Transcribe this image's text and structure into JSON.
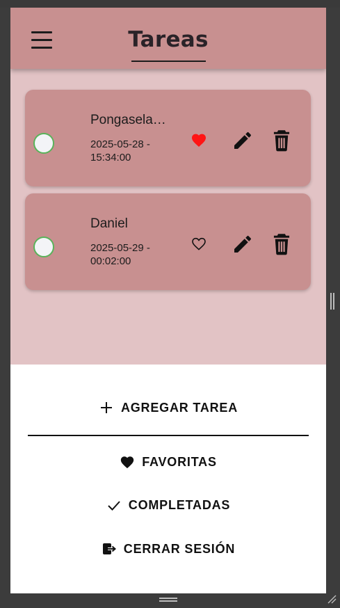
{
  "header": {
    "title": "Tareas",
    "menu_icon": "hamburger-menu-icon"
  },
  "tasks": [
    {
      "name": "Pongasela…",
      "date_line1": "2025-05-28 -",
      "date_line2": "15:34:00",
      "favorite": true,
      "completed": false
    },
    {
      "name": "Daniel",
      "date_line1": "2025-05-29 -",
      "date_line2": "00:02:00",
      "favorite": false,
      "completed": false
    }
  ],
  "actions": {
    "add_label": "AGREGAR TAREA",
    "favorites_label": "FAVORITAS",
    "completed_label": "COMPLETADAS",
    "logout_label": "CERRAR SESIÓN"
  },
  "colors": {
    "header_bg": "#c89090",
    "list_bg": "#e2c3c5",
    "card_bg": "#c89090",
    "favorite_red": "#ff1414",
    "check_border": "#59b35a"
  }
}
